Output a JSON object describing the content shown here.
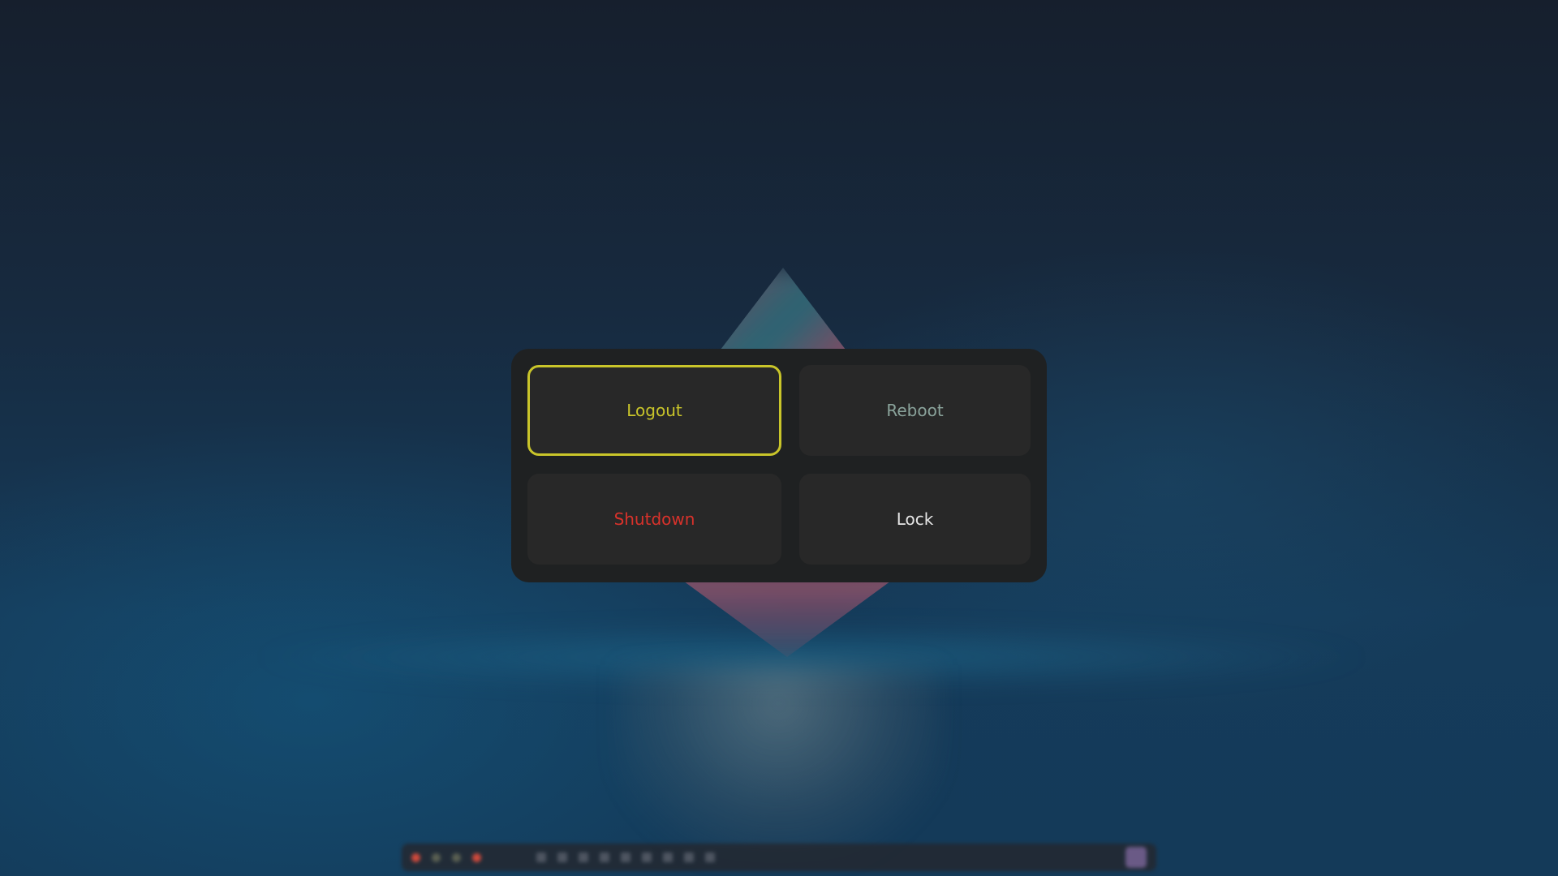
{
  "power_menu": {
    "options": [
      {
        "label": "Logout",
        "color": "#c9c52a",
        "selected": true
      },
      {
        "label": "Reboot",
        "color": "#8aa39b",
        "selected": false
      },
      {
        "label": "Shutdown",
        "color": "#d9322b",
        "selected": false
      },
      {
        "label": "Lock",
        "color": "#e6e6e6",
        "selected": false
      }
    ]
  },
  "taskbar": {
    "workspace_colors": [
      "#d04a3c",
      "#5a5f52",
      "#5a5f52",
      "#d04a3c"
    ]
  },
  "colors": {
    "menu_background": "#1f2122",
    "button_background": "#282828",
    "selected_border": "#c9c52a"
  }
}
